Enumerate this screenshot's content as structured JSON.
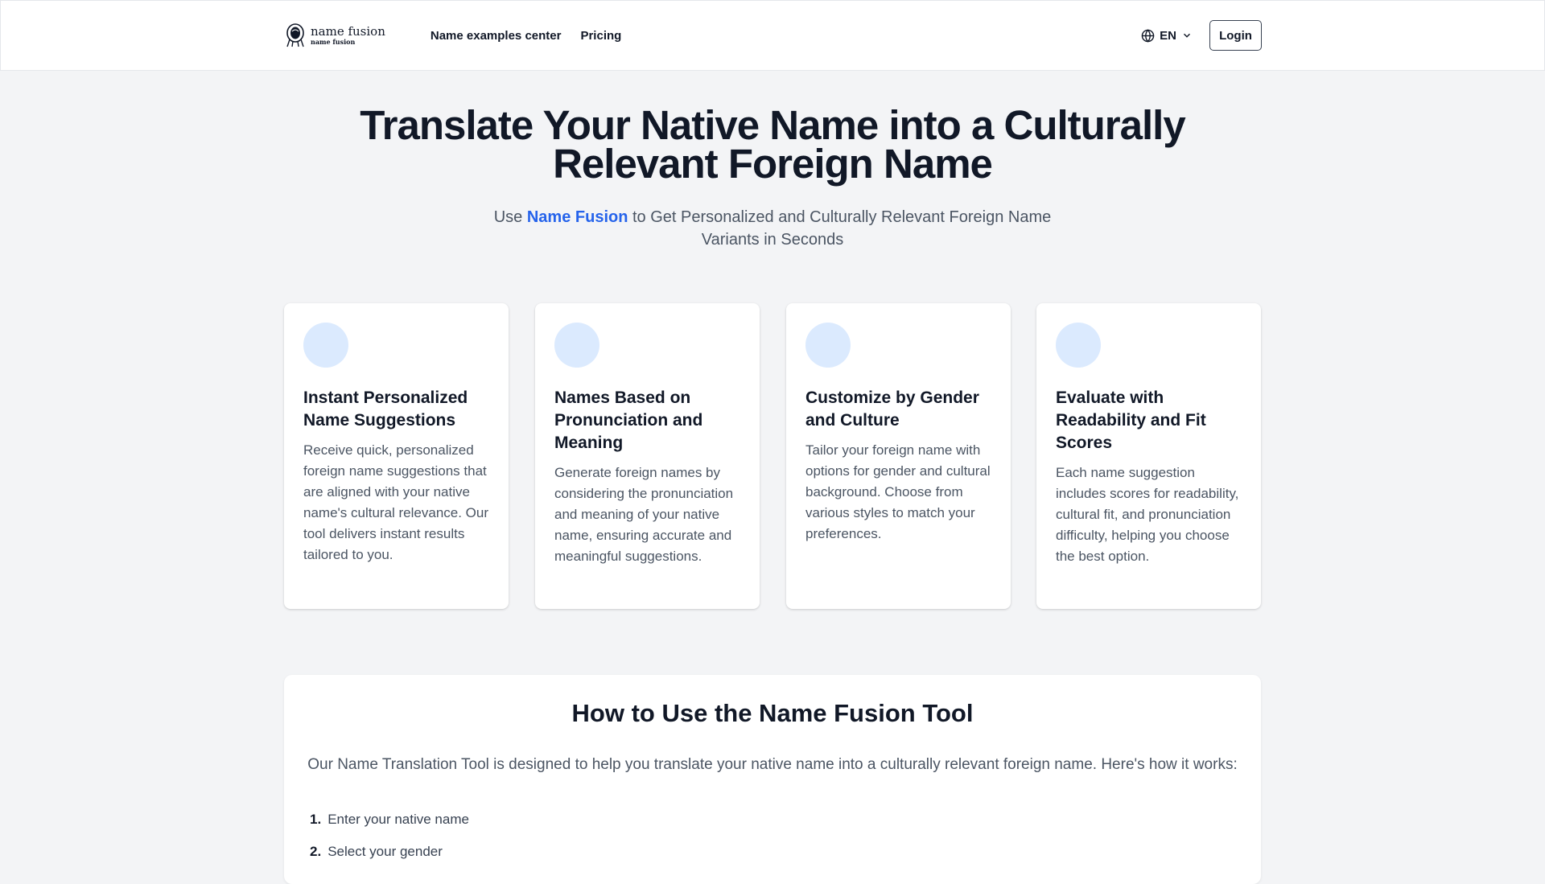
{
  "nav": {
    "logo_main": "name fusion",
    "logo_sub": "name fusion",
    "links": [
      "Name examples center",
      "Pricing"
    ],
    "language": "EN",
    "login": "Login"
  },
  "hero": {
    "title": "Translate Your Native Name into a Culturally Relevant Foreign Name",
    "subtitle_pre": "Use ",
    "subtitle_brand": "Name Fusion",
    "subtitle_post": " to Get Personalized and Culturally Relevant Foreign Name Variants in Seconds"
  },
  "features": [
    {
      "title": "Instant Personalized Name Suggestions",
      "description": "Receive quick, personalized foreign name suggestions that are aligned with your native name's cultural relevance. Our tool delivers instant results tailored to you."
    },
    {
      "title": "Names Based on Pronunciation and Meaning",
      "description": "Generate foreign names by considering the pronunciation and meaning of your native name, ensuring accurate and meaningful suggestions."
    },
    {
      "title": "Customize by Gender and Culture",
      "description": "Tailor your foreign name with options for gender and cultural background. Choose from various styles to match your preferences."
    },
    {
      "title": "Evaluate with Readability and Fit Scores",
      "description": "Each name suggestion includes scores for readability, cultural fit, and pronunciation difficulty, helping you choose the best option."
    }
  ],
  "howto": {
    "title": "How to Use the Name Fusion Tool",
    "intro": "Our Name Translation Tool is designed to help you translate your native name into a culturally relevant foreign name. Here's how it works:",
    "steps": [
      {
        "num": "1.",
        "text": "Enter your native name"
      },
      {
        "num": "2.",
        "text": "Select your gender"
      }
    ]
  },
  "colors": {
    "accent": "#2563eb",
    "icon_circle": "#dbeafe",
    "background": "#f3f4f6"
  }
}
